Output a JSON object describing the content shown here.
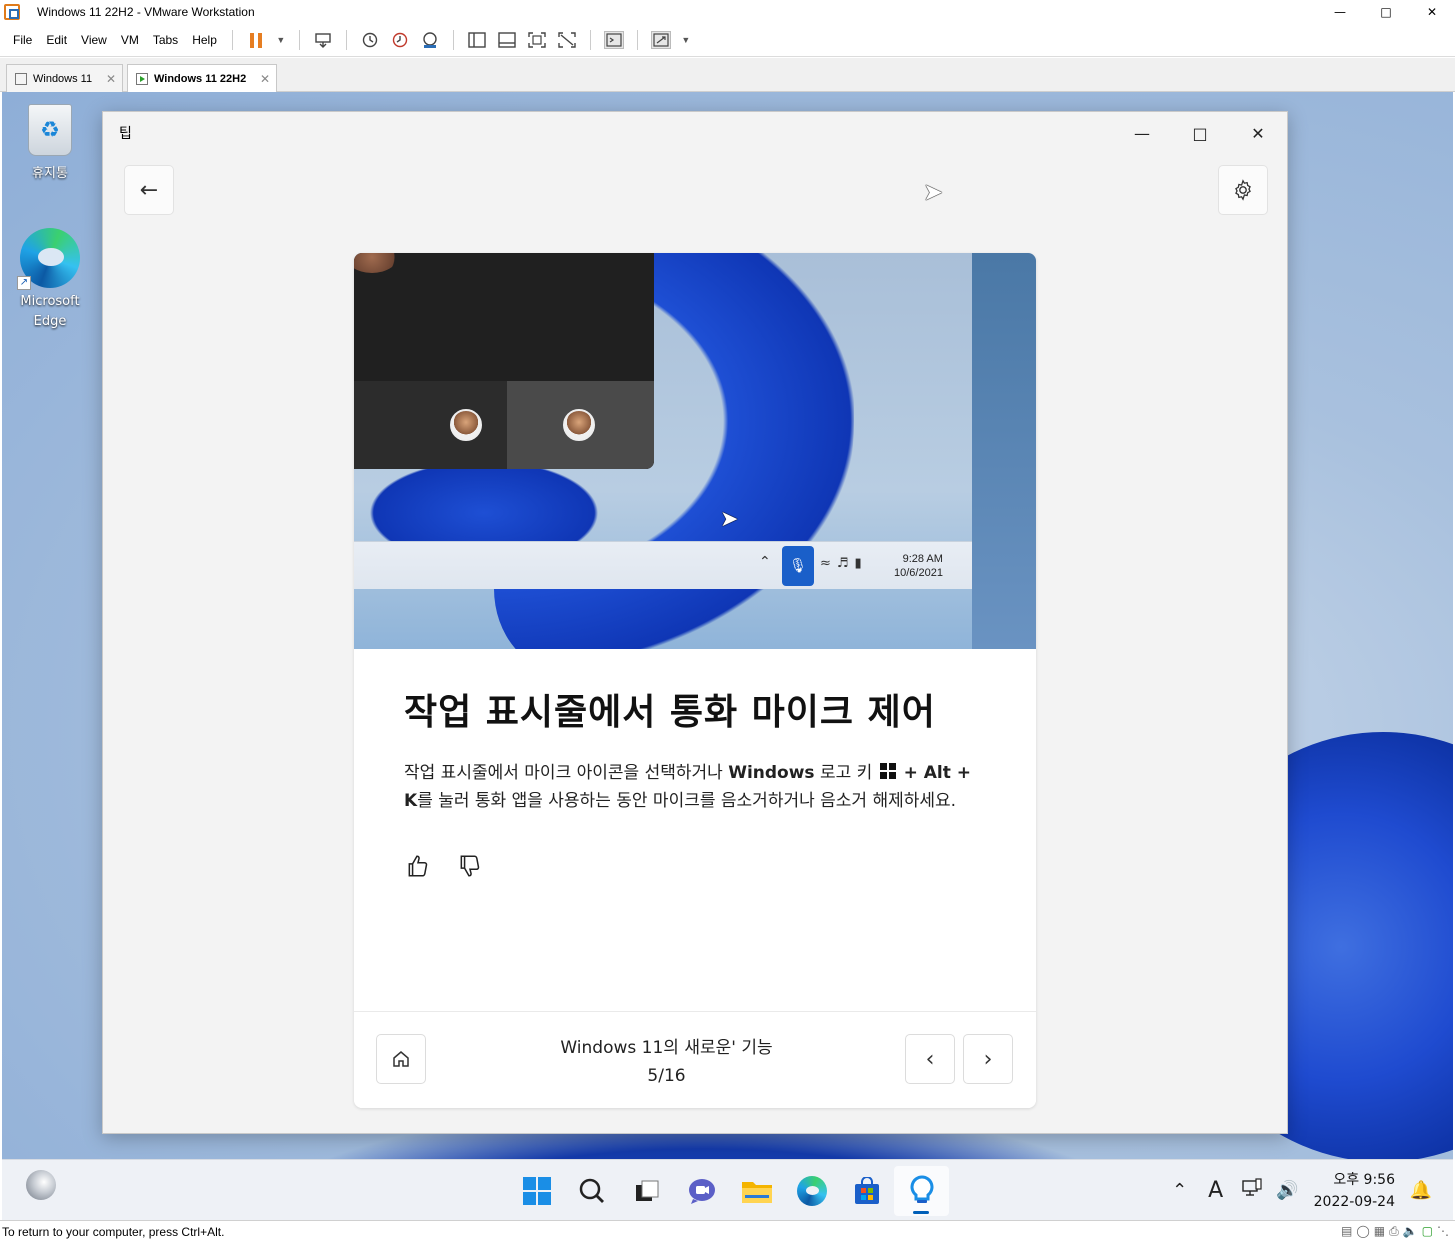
{
  "vmware": {
    "window_title": "Windows 11 22H2 - VMware Workstation",
    "menu": [
      "File",
      "Edit",
      "View",
      "VM",
      "Tabs",
      "Help"
    ],
    "tabs": [
      {
        "label": "Windows 11",
        "active": false
      },
      {
        "label": "Windows 11 22H2",
        "active": true
      }
    ],
    "status_text": "To return to your computer, press Ctrl+Alt."
  },
  "desktop": {
    "icons": [
      {
        "label": "휴지통",
        "icon": "recycle-bin-icon"
      },
      {
        "label": "Microsoft Edge",
        "icon": "edge-icon"
      }
    ]
  },
  "tips_app": {
    "title": "팁",
    "headline": "작업 표시줄에서 통화 마이크 제어",
    "description": {
      "part1": "작업 표시줄에서 마이크 아이콘을 선택하거나 ",
      "bold1": "Windows",
      "part2": " 로고 키 ",
      "bold2": " + Alt + K",
      "part3": "를 눌러 통화 앱을 사용하는 동안 마이크를 음소거하거나 음소거 해제하세요."
    },
    "illustration": {
      "time": "9:28 AM",
      "date": "10/6/2021"
    },
    "footer": {
      "collection": "Windows 11의 새로운' 기능",
      "page": "5/16"
    }
  },
  "taskbar": {
    "apps": [
      "start",
      "search",
      "task-view",
      "chat",
      "file-explorer",
      "edge",
      "store",
      "tips"
    ],
    "active_app": "tips",
    "clock_time": "오후 9:56",
    "clock_date": "2022-09-24",
    "ime": "A"
  }
}
